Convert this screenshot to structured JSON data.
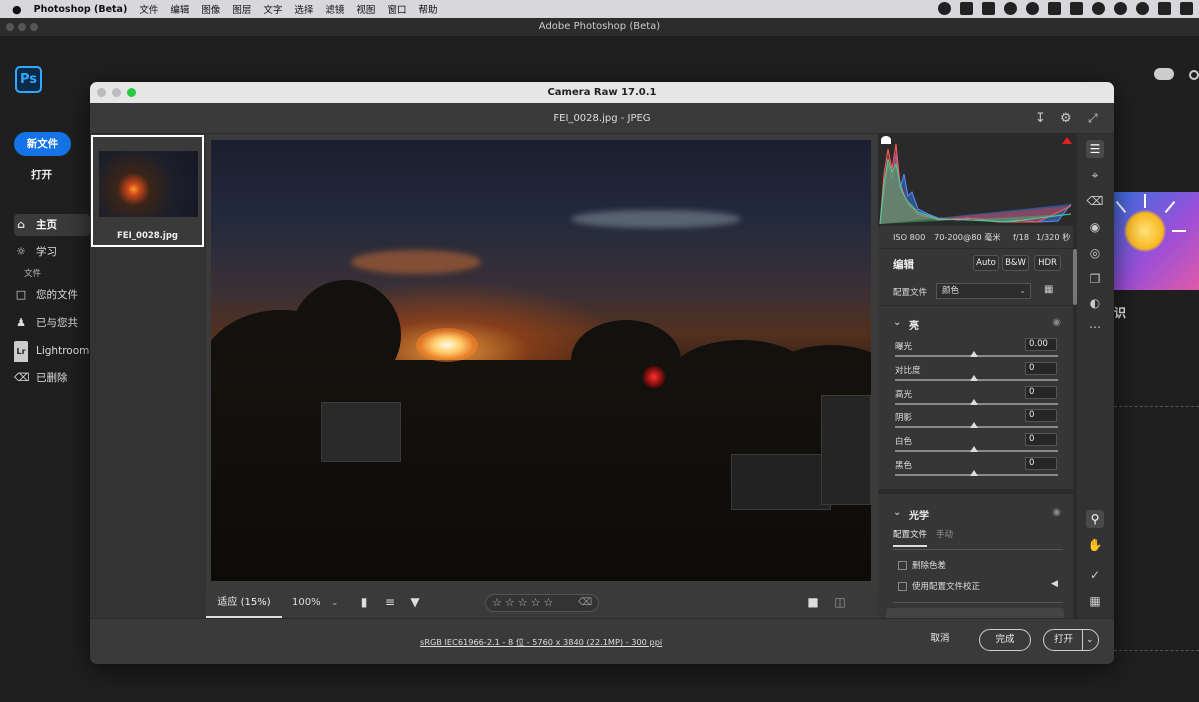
{
  "menubar": {
    "apple": "",
    "app_name": "Photoshop (Beta)",
    "items": [
      "文件",
      "编辑",
      "图像",
      "图层",
      "文字",
      "选择",
      "滤镜",
      "视图",
      "窗口",
      "帮助"
    ]
  },
  "ps_window": {
    "title": "Adobe Photoshop (Beta)",
    "logo": "Ps",
    "new_file": "新文件",
    "open": "打开",
    "nav": [
      {
        "label": "主页",
        "icon": "home-icon"
      },
      {
        "label": "学习",
        "icon": "lightbulb-icon"
      }
    ],
    "files_section": "文件",
    "file_nav": [
      {
        "label": "您的文件",
        "icon": "file-icon"
      },
      {
        "label": "已与您共",
        "icon": "shared-users-icon"
      },
      {
        "label": "Lightroom",
        "icon": "lightroom-icon"
      },
      {
        "label": "已删除",
        "icon": "trash-icon"
      }
    ],
    "right_partial_text": "识"
  },
  "camera_raw": {
    "title": "Camera Raw 17.0.1",
    "file_header": "FEI_0028.jpg -  JPEG",
    "thumbnail_name": "FEI_0028.jpg",
    "bottom": {
      "fit_label": "适应 (15%)",
      "zoom_label": "100%",
      "rating_stars": "☆☆☆☆☆"
    },
    "histogram": {
      "meta": [
        "ISO 800",
        "70-200@80 毫米",
        "f/18",
        "1/320 秒"
      ]
    },
    "edit": {
      "title": "编辑",
      "buttons": [
        "Auto",
        "B&W",
        "HDR"
      ],
      "profile_label": "配置文件",
      "profile_value": "颜色"
    },
    "light": {
      "title": "亮",
      "sliders": [
        {
          "label": "曝光",
          "value": "0.00"
        },
        {
          "label": "对比度",
          "value": "0"
        },
        {
          "label": "高光",
          "value": "0"
        },
        {
          "label": "阴影",
          "value": "0"
        },
        {
          "label": "白色",
          "value": "0"
        },
        {
          "label": "黑色",
          "value": "0"
        }
      ]
    },
    "optics": {
      "title": "光学",
      "tab_active": "配置文件",
      "tab_other": "手动",
      "checkboxes": [
        "删除色差",
        "使用配置文件校正"
      ]
    },
    "footer": {
      "color_info": "sRGB IEC61966-2.1 - 8 位 - 5760 x 3840 (22.1MP) - 300 ppi",
      "cancel": "取消",
      "done": "完成",
      "open": "打开"
    }
  },
  "colors": {
    "accent_blue": "#1473e6",
    "panel_bg": "#363636",
    "window_bg": "#1f1f1f"
  }
}
